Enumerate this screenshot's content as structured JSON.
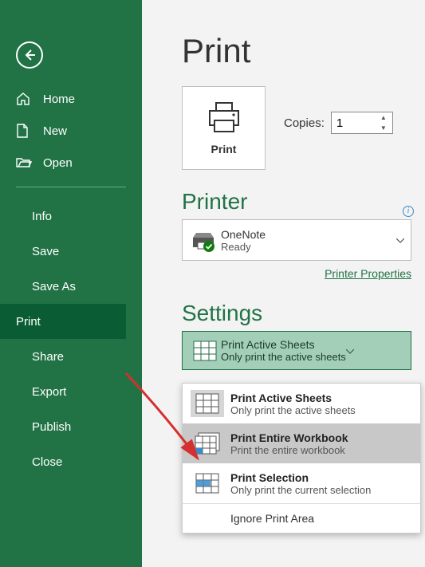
{
  "sidebar": {
    "nav": [
      {
        "label": "Home"
      },
      {
        "label": "New"
      },
      {
        "label": "Open"
      }
    ],
    "sub": [
      {
        "label": "Info"
      },
      {
        "label": "Save"
      },
      {
        "label": "Save As"
      },
      {
        "label": "Print"
      },
      {
        "label": "Share"
      },
      {
        "label": "Export"
      },
      {
        "label": "Publish"
      },
      {
        "label": "Close"
      }
    ]
  },
  "page": {
    "title": "Print",
    "print_button": "Print",
    "copies_label": "Copies:",
    "copies_value": "1"
  },
  "printer": {
    "heading": "Printer",
    "name": "OneNote",
    "status": "Ready",
    "properties_link": "Printer Properties"
  },
  "settings": {
    "heading": "Settings",
    "selected": {
      "title": "Print Active Sheets",
      "subtitle": "Only print the active sheets"
    },
    "options": [
      {
        "title": "Print Active Sheets",
        "subtitle": "Only print the active sheets"
      },
      {
        "title": "Print Entire Workbook",
        "subtitle": "Print the entire workbook"
      },
      {
        "title": "Print Selection",
        "subtitle": "Only print the current selection"
      }
    ],
    "ignore": "Ignore Print Area"
  }
}
